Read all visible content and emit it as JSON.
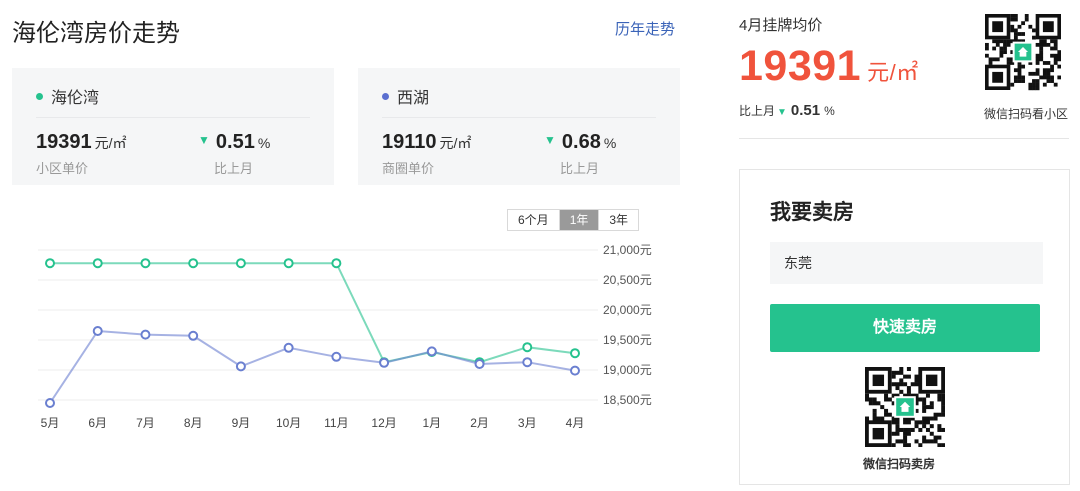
{
  "header": {
    "title": "海伦湾房价走势",
    "history_link": "历年走势"
  },
  "cards": [
    {
      "name": "海伦湾",
      "dot_color": "#25c28e",
      "price": "19391",
      "unit": "元/㎡",
      "price_label": "小区单价",
      "change": "0.51",
      "change_unit": "%",
      "change_label": "比上月",
      "trend": "down"
    },
    {
      "name": "西湖",
      "dot_color": "#5b6fd0",
      "price": "19110",
      "unit": "元/㎡",
      "price_label": "商圈单价",
      "change": "0.68",
      "change_unit": "%",
      "change_label": "比上月",
      "trend": "down"
    }
  ],
  "range_tabs": {
    "items": [
      "6个月",
      "1年",
      "3年"
    ],
    "active": "1年"
  },
  "chart_data": {
    "type": "line",
    "categories": [
      "5月",
      "6月",
      "7月",
      "8月",
      "9月",
      "10月",
      "11月",
      "12月",
      "1月",
      "2月",
      "3月",
      "4月"
    ],
    "series": [
      {
        "color": "#25c28e",
        "values": [
          20780,
          20780,
          20780,
          20780,
          20780,
          20780,
          20780,
          19130,
          19300,
          19130,
          19380,
          19280
        ]
      },
      {
        "color": "#6a7fd0",
        "values": [
          18450,
          19650,
          19590,
          19570,
          19060,
          19370,
          19220,
          19120,
          19310,
          19100,
          19130,
          18990
        ]
      }
    ],
    "ylim": [
      18500,
      21000
    ],
    "yticks": [
      21000,
      20500,
      20000,
      19500,
      19000,
      18500
    ],
    "ytick_labels": [
      "21,000元",
      "20,500元",
      "20,000元",
      "19,500元",
      "19,000元",
      "18,500元"
    ],
    "grid": true
  },
  "right": {
    "label": "4月挂牌均价",
    "price": "19391",
    "unit": "元/㎡",
    "change_label": "比上月",
    "change": "0.51",
    "change_unit": "%",
    "qr_caption": "微信扫码看小区"
  },
  "sell": {
    "title": "我要卖房",
    "city_value": "东莞",
    "button_label": "快速卖房",
    "qr_caption": "微信扫码卖房"
  },
  "colors": {
    "accent_green": "#25c28e",
    "price_red": "#f0533c",
    "link_blue": "#3a63b8",
    "series_blue": "#6a7fd0"
  }
}
